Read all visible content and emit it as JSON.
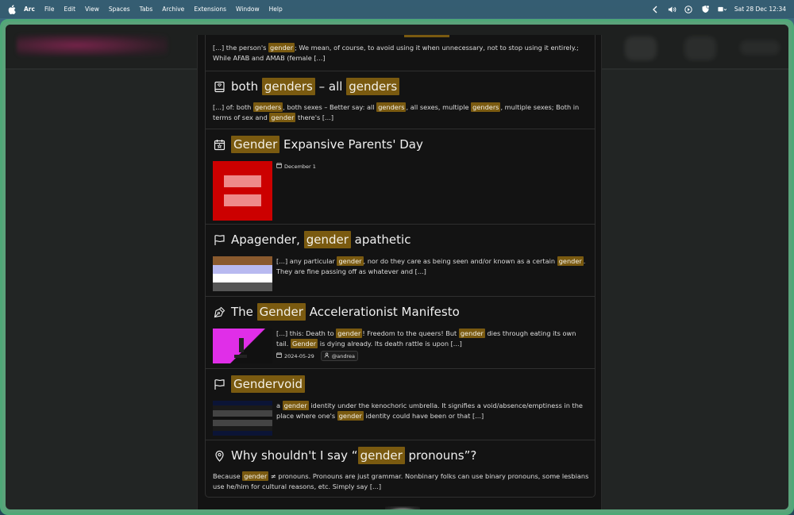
{
  "menubar": {
    "app": "Arc",
    "items": [
      "File",
      "Edit",
      "View",
      "Spaces",
      "Tabs",
      "Archive",
      "Extensions",
      "Window",
      "Help"
    ],
    "clock": "Sat 28 Dec  12:34"
  },
  "results": [
    {
      "icon": "partial",
      "title": "",
      "body": [
        {
          "t": "[...] the person's "
        },
        {
          "h": "gender"
        },
        {
          "t": "; We mean, of course, to avoid using it when unnecessary, not to stop using it entirely.; While AFAB and AMAB (female [...]"
        }
      ]
    },
    {
      "icon": "book-icon",
      "title": [
        {
          "t": "both "
        },
        {
          "h": "genders"
        },
        {
          "t": " – all "
        },
        {
          "h": "genders"
        }
      ],
      "body": [
        {
          "t": "[...] of: both "
        },
        {
          "h": "genders"
        },
        {
          "t": ", both sexes – Better say: all "
        },
        {
          "h": "genders"
        },
        {
          "t": ", all sexes, multiple "
        },
        {
          "h": "genders"
        },
        {
          "t": ", multiple sexes; Both in terms of sex and "
        },
        {
          "h": "gender"
        },
        {
          "t": " there's [...]"
        }
      ]
    },
    {
      "icon": "calendar-star-icon",
      "title": [
        {
          "h": "Gender"
        },
        {
          "t": " Expansive Parents' Day"
        }
      ],
      "date": "December 1"
    },
    {
      "icon": "flag-icon",
      "title": [
        {
          "t": "Apagender, "
        },
        {
          "h": "gender"
        },
        {
          "t": " apathetic"
        }
      ],
      "body": [
        {
          "t": "[...] any particular "
        },
        {
          "h": "gender"
        },
        {
          "t": ", nor do they care as being seen and/or known as a certain "
        },
        {
          "h": "gender"
        },
        {
          "t": ". They are fine passing off as whatever and [...]"
        }
      ]
    },
    {
      "icon": "pen-icon",
      "title": [
        {
          "t": "The "
        },
        {
          "h": "Gender"
        },
        {
          "t": " Accelerationist Manifesto"
        }
      ],
      "body": [
        {
          "t": "[...] this: Death to "
        },
        {
          "h": "gender"
        },
        {
          "t": "! Freedom to the queers! But "
        },
        {
          "h": "gender"
        },
        {
          "t": " dies through eating its own tail. "
        },
        {
          "h": "Gender"
        },
        {
          "t": " is dying already. Its death rattle is upon [...]"
        }
      ],
      "date": "2024-05-29",
      "author": "@andrea"
    },
    {
      "icon": "flag-icon",
      "title": [
        {
          "h": "Gendervoid"
        }
      ],
      "body": [
        {
          "t": "a "
        },
        {
          "h": "gender"
        },
        {
          "t": " identity under the kenochoric umbrella. It signifies a void/absence/emptiness in the place where one's "
        },
        {
          "h": "gender"
        },
        {
          "t": " identity could have been or that [...]"
        }
      ]
    },
    {
      "icon": "map-pin-icon",
      "title": [
        {
          "t": "Why shouldn't I say “"
        },
        {
          "h": "gender"
        },
        {
          "t": " pronouns”?"
        }
      ],
      "body": [
        {
          "t": "Because "
        },
        {
          "h": "gender"
        },
        {
          "t": " ≠ pronouns. Pronouns are just grammar. Nonbinary folks can use binary pronouns, some lesbians use he/him for cultural reasons, etc. Simply say [...]"
        }
      ]
    }
  ],
  "colors": {
    "highlight": "#7a5a10",
    "window_border": "#4fa877",
    "panel": "#131313"
  }
}
